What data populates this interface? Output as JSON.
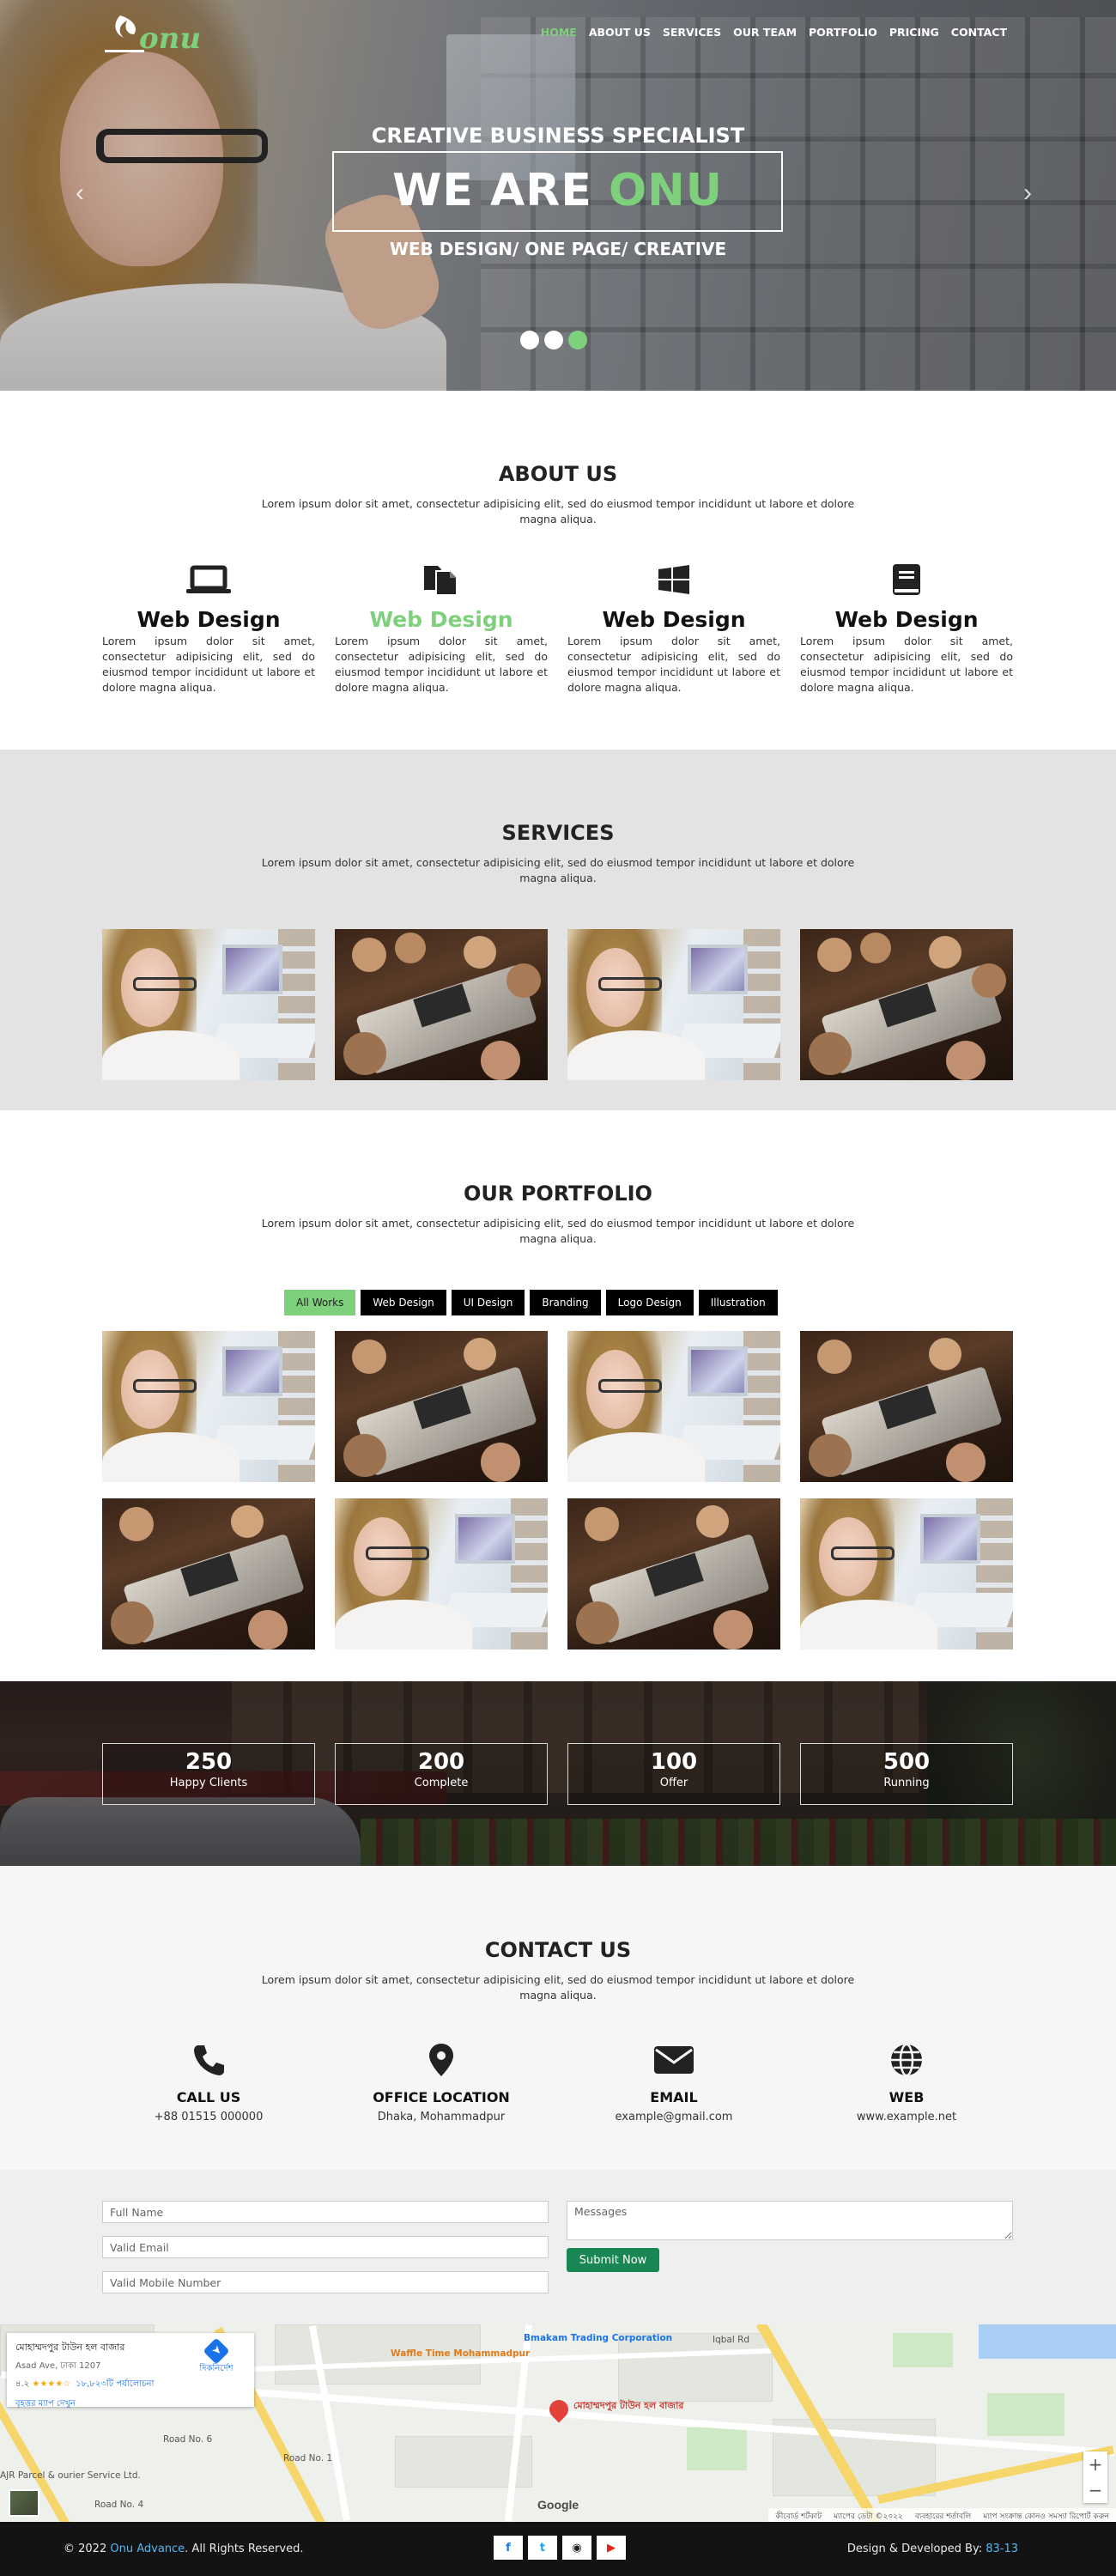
{
  "header": {
    "logo_text": "onu",
    "nav": [
      "HOME",
      "ABOUT US",
      "SERVICES",
      "OUR TEAM",
      "PORTFOLIO",
      "PRICING",
      "CONTACT"
    ],
    "active_nav": "HOME",
    "accent": "#7ed07c"
  },
  "hero": {
    "subtitle": "CREATIVE BUSINESS SPECIALIST",
    "title_prefix": "WE ARE ",
    "title_highlight": "ONU",
    "tagline": "WEB DESIGN/ ONE PAGE/ CREATIVE",
    "prev_icon": "chevron-left-icon",
    "next_icon": "chevron-right-icon",
    "slides": 3,
    "active_slide": 3
  },
  "about": {
    "title": "ABOUT US",
    "desc": "Lorem ipsum dolor sit amet, consectetur adipisicing elit, sed do eiusmod tempor incididunt ut labore et dolore magna aliqua.",
    "features": [
      {
        "icon": "laptop-icon",
        "title": "Web Design",
        "text": "Lorem ipsum dolor sit amet, consectetur adipisicing elit, sed do eiusmod tempor incididunt ut labore et dolore magna aliqua."
      },
      {
        "icon": "copy-icon",
        "title": "Web Design",
        "text": "Lorem ipsum dolor sit amet, consectetur adipisicing elit, sed do eiusmod tempor incididunt ut labore et dolore magna aliqua."
      },
      {
        "icon": "windows-icon",
        "title": "Web Design",
        "text": "Lorem ipsum dolor sit amet, consectetur adipisicing elit, sed do eiusmod tempor incididunt ut labore et dolore magna aliqua."
      },
      {
        "icon": "book-icon",
        "title": "Web Design",
        "text": "Lorem ipsum dolor sit amet, consectetur adipisicing elit, sed do eiusmod tempor incididunt ut labore et dolore magna aliqua."
      }
    ]
  },
  "services": {
    "title": "SERVICES",
    "desc": "Lorem ipsum dolor sit amet, consectetur adipisicing elit, sed do eiusmod tempor incididunt ut labore et dolore magna aliqua."
  },
  "portfolio": {
    "title": "OUR PORTFOLIO",
    "desc": "Lorem ipsum dolor sit amet, consectetur adipisicing elit, sed do eiusmod tempor incididunt ut labore et dolore magna aliqua.",
    "filters": [
      "All Works",
      "Web Design",
      "UI Design",
      "Branding",
      "Logo Design",
      "Illustration"
    ],
    "active_filter": "All Works"
  },
  "stats": [
    {
      "value": "250",
      "label": "Happy Clients"
    },
    {
      "value": "200",
      "label": "Complete"
    },
    {
      "value": "100",
      "label": "Offer"
    },
    {
      "value": "500",
      "label": "Running"
    }
  ],
  "contact": {
    "title": "CONTACT US",
    "desc": "Lorem ipsum dolor sit amet, consectetur adipisicing elit, sed do eiusmod tempor incididunt ut labore et dolore magna aliqua.",
    "items": [
      {
        "icon": "phone-icon",
        "label": "CALL US",
        "value": "+88 01515 000000"
      },
      {
        "icon": "location-pin-icon",
        "label": "OFFICE LOCATION",
        "value": "Dhaka, Mohammadpur"
      },
      {
        "icon": "envelope-icon",
        "label": "EMAIL",
        "value": "example@gmail.com"
      },
      {
        "icon": "globe-icon",
        "label": "WEB",
        "value": "www.example.net"
      }
    ]
  },
  "form": {
    "name_placeholder": "Full Name",
    "email_placeholder": "Valid Email",
    "mobile_placeholder": "Valid Mobile Number",
    "message_placeholder": "Messages",
    "submit_label": "Submit Now",
    "submit_color": "#198754"
  },
  "map": {
    "place_name": "মোহাম্মদপুর টাউন হল বাজার",
    "address": "Asad Ave, ঢাকা 1207",
    "rating": "৪.২",
    "reviews": "১৮,৮২৩টি পর্যালোচনা",
    "larger_map": "বৃহত্তর ম্যাপ দেখুন",
    "directions": "দিকনির্দেশ",
    "pin_label": "মোহাম্মদপুর টাউন হল বাজার",
    "labels": [
      "Bmakam Trading Corporation",
      "Waffle Time Mohammadpur",
      "AJR Parcel & ourier Service Ltd.",
      "Road No. 4",
      "Road No. 1",
      "Road No. 6",
      "Iqbal Rd",
      "Google"
    ],
    "footer": [
      "কীবোর্ড শর্টকাট",
      "ম্যাপের ডেটা ©২০২২",
      "ব্যবহারের শর্তাবলি",
      "ম্যাপ সংক্রান্ত কোনও সমস্যা রিপোর্ট করুন"
    ],
    "zoom_in": "+",
    "zoom_out": "−"
  },
  "footer": {
    "copy_prefix": "© 2022 ",
    "copy_link": "Onu Advance",
    "copy_suffix": ". All Rights Reserved.",
    "credit_prefix": "Design & Developed By: ",
    "credit_link": "83-13",
    "socials": [
      {
        "icon": "facebook-icon",
        "glyph": "f",
        "color": "#1877f2"
      },
      {
        "icon": "twitter-icon",
        "glyph": "t",
        "color": "#1da1f2"
      },
      {
        "icon": "github-icon",
        "glyph": "◉",
        "color": "#222222"
      },
      {
        "icon": "youtube-icon",
        "glyph": "▶",
        "color": "#e62117"
      }
    ]
  }
}
